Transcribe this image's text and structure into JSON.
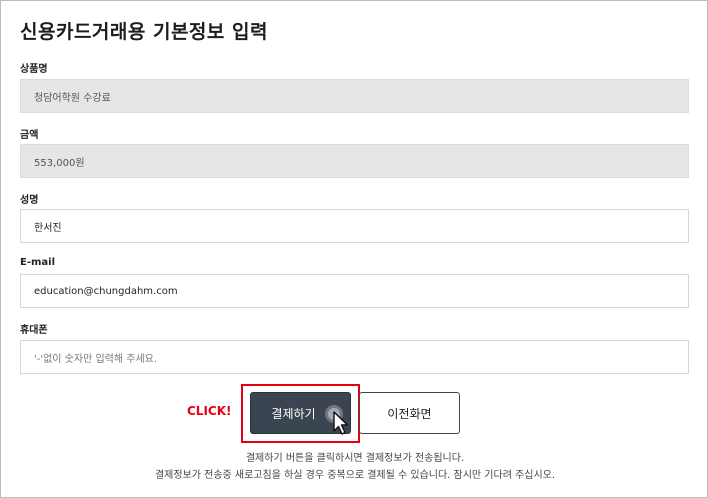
{
  "page": {
    "title": "신용카드거래용 기본정보 입력"
  },
  "fields": {
    "product": {
      "label": "상품명",
      "value": "청담어학원 수강료"
    },
    "amount": {
      "label": "금액",
      "value": "553,000원"
    },
    "name": {
      "label": "성명",
      "value": "한서진"
    },
    "email": {
      "label": "E-mail",
      "value": "education@chungdahm.com"
    },
    "phone": {
      "label": "휴대폰",
      "placeholder": "'-'없이 숫자만 입력해 주세요."
    }
  },
  "actions": {
    "click_hint": "CLICK!",
    "pay_label": "결제하기",
    "prev_label": "이전화면"
  },
  "notices": {
    "line1": "결제하기 버튼을 클릭하시면 결제정보가 전송됩니다.",
    "line2": "결제정보가 전송중 새로고침을 하실 경우 중복으로 결제될 수 있습니다. 잠시만 기다려 주십시오."
  },
  "colors": {
    "highlight": "#e60012",
    "pay_button_bg": "#3b4551",
    "readonly_bg": "#e6e6e6"
  }
}
